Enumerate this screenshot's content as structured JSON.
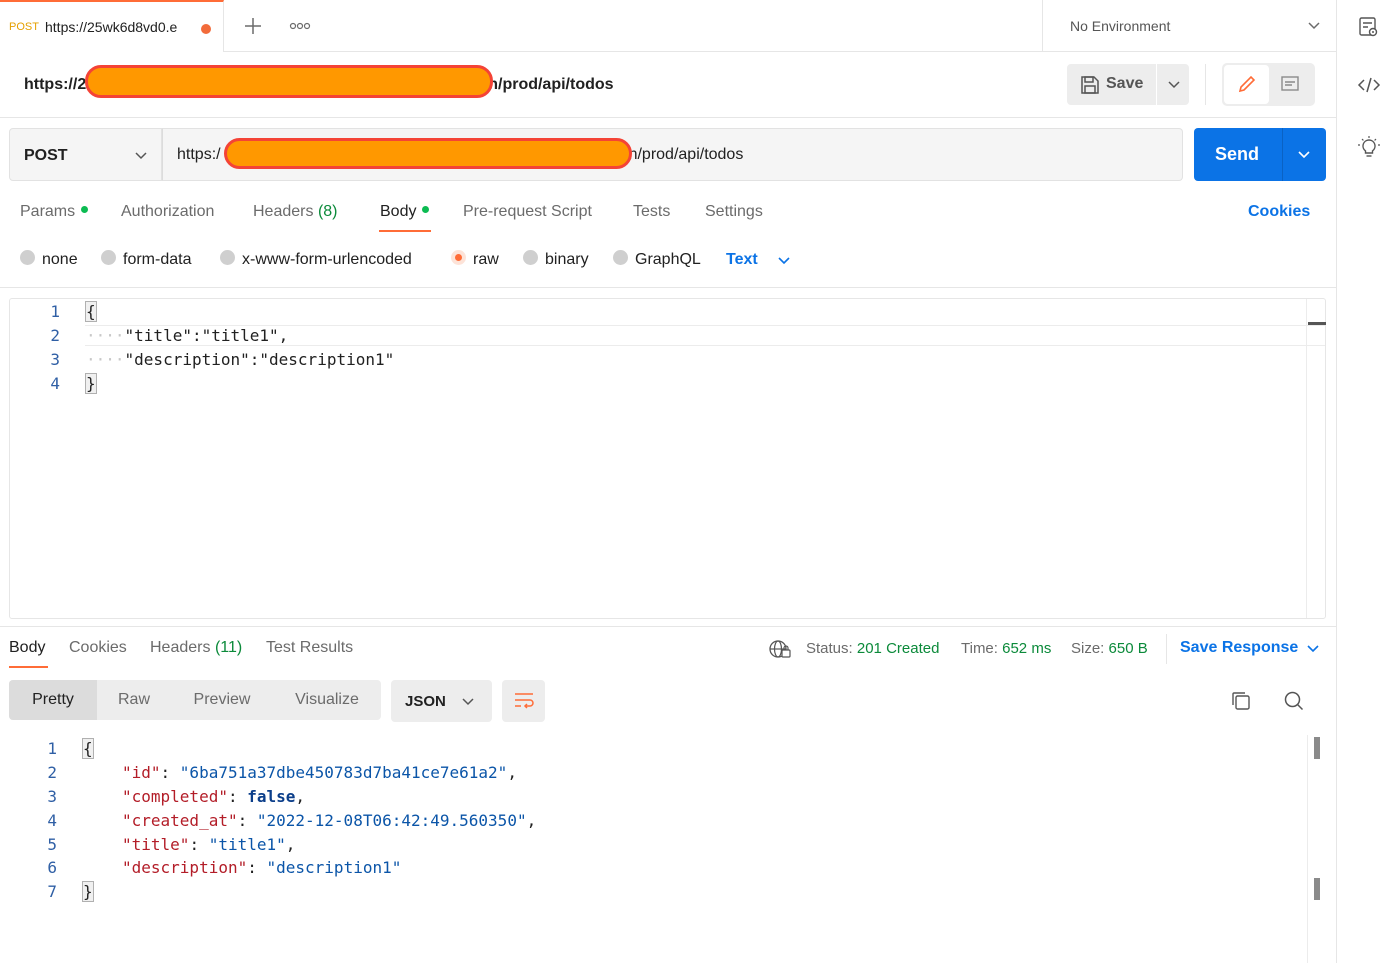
{
  "tab": {
    "method": "POST",
    "url": "https://25wk6d8vd0.e"
  },
  "environment": {
    "label": "No Environment"
  },
  "request": {
    "title_prefix": "https://2",
    "title_suffix": "n/prod/api/todos",
    "save_label": "Save",
    "method": "POST",
    "url_prefix": "https:/",
    "url_suffix": "n/prod/api/todos",
    "send_label": "Send"
  },
  "request_tabs": [
    {
      "label": "Params",
      "dot": true
    },
    {
      "label": "Authorization"
    },
    {
      "label": "Headers",
      "count": "(8)"
    },
    {
      "label": "Body",
      "dot": true,
      "active": true
    },
    {
      "label": "Pre-request Script"
    },
    {
      "label": "Tests"
    },
    {
      "label": "Settings"
    }
  ],
  "cookies_label": "Cookies",
  "body_types": [
    {
      "label": "none"
    },
    {
      "label": "form-data"
    },
    {
      "label": "x-www-form-urlencoded"
    },
    {
      "label": "raw",
      "selected": true
    },
    {
      "label": "binary"
    },
    {
      "label": "GraphQL"
    }
  ],
  "raw_type": "Text",
  "request_body": {
    "line_numbers": [
      "1",
      "2",
      "3",
      "4"
    ],
    "lines": [
      "{",
      "\"title\":\"title1\",",
      "\"description\":\"description1\"",
      "}"
    ]
  },
  "response_tabs": [
    {
      "label": "Body",
      "active": true
    },
    {
      "label": "Cookies"
    },
    {
      "label": "Headers",
      "count": "(11)"
    },
    {
      "label": "Test Results"
    }
  ],
  "response_meta": {
    "status_label": "Status:",
    "status": "201 Created",
    "time_label": "Time:",
    "time": "652 ms",
    "size_label": "Size:",
    "size": "650 B",
    "save_response": "Save Response"
  },
  "view_modes": [
    "Pretty",
    "Raw",
    "Preview",
    "Visualize"
  ],
  "format": "JSON",
  "response_body": {
    "line_numbers": [
      "1",
      "2",
      "3",
      "4",
      "5",
      "6",
      "7"
    ],
    "open": "{",
    "close": "}",
    "fields": [
      {
        "key": "\"id\"",
        "value": "\"6ba751a37dbe450783d7ba41ce7e61a2\"",
        "type": "string"
      },
      {
        "key": "\"completed\"",
        "value": "false",
        "type": "keyword"
      },
      {
        "key": "\"created_at\"",
        "value": "\"2022-12-08T06:42:49.560350\"",
        "type": "string"
      },
      {
        "key": "\"title\"",
        "value": "\"title1\"",
        "type": "string"
      },
      {
        "key": "\"description\"",
        "value": "\"description1\"",
        "type": "string"
      }
    ]
  },
  "colors": {
    "accent": "#ff6c37",
    "primary": "#0b73e6",
    "success": "#0b8a3a"
  }
}
